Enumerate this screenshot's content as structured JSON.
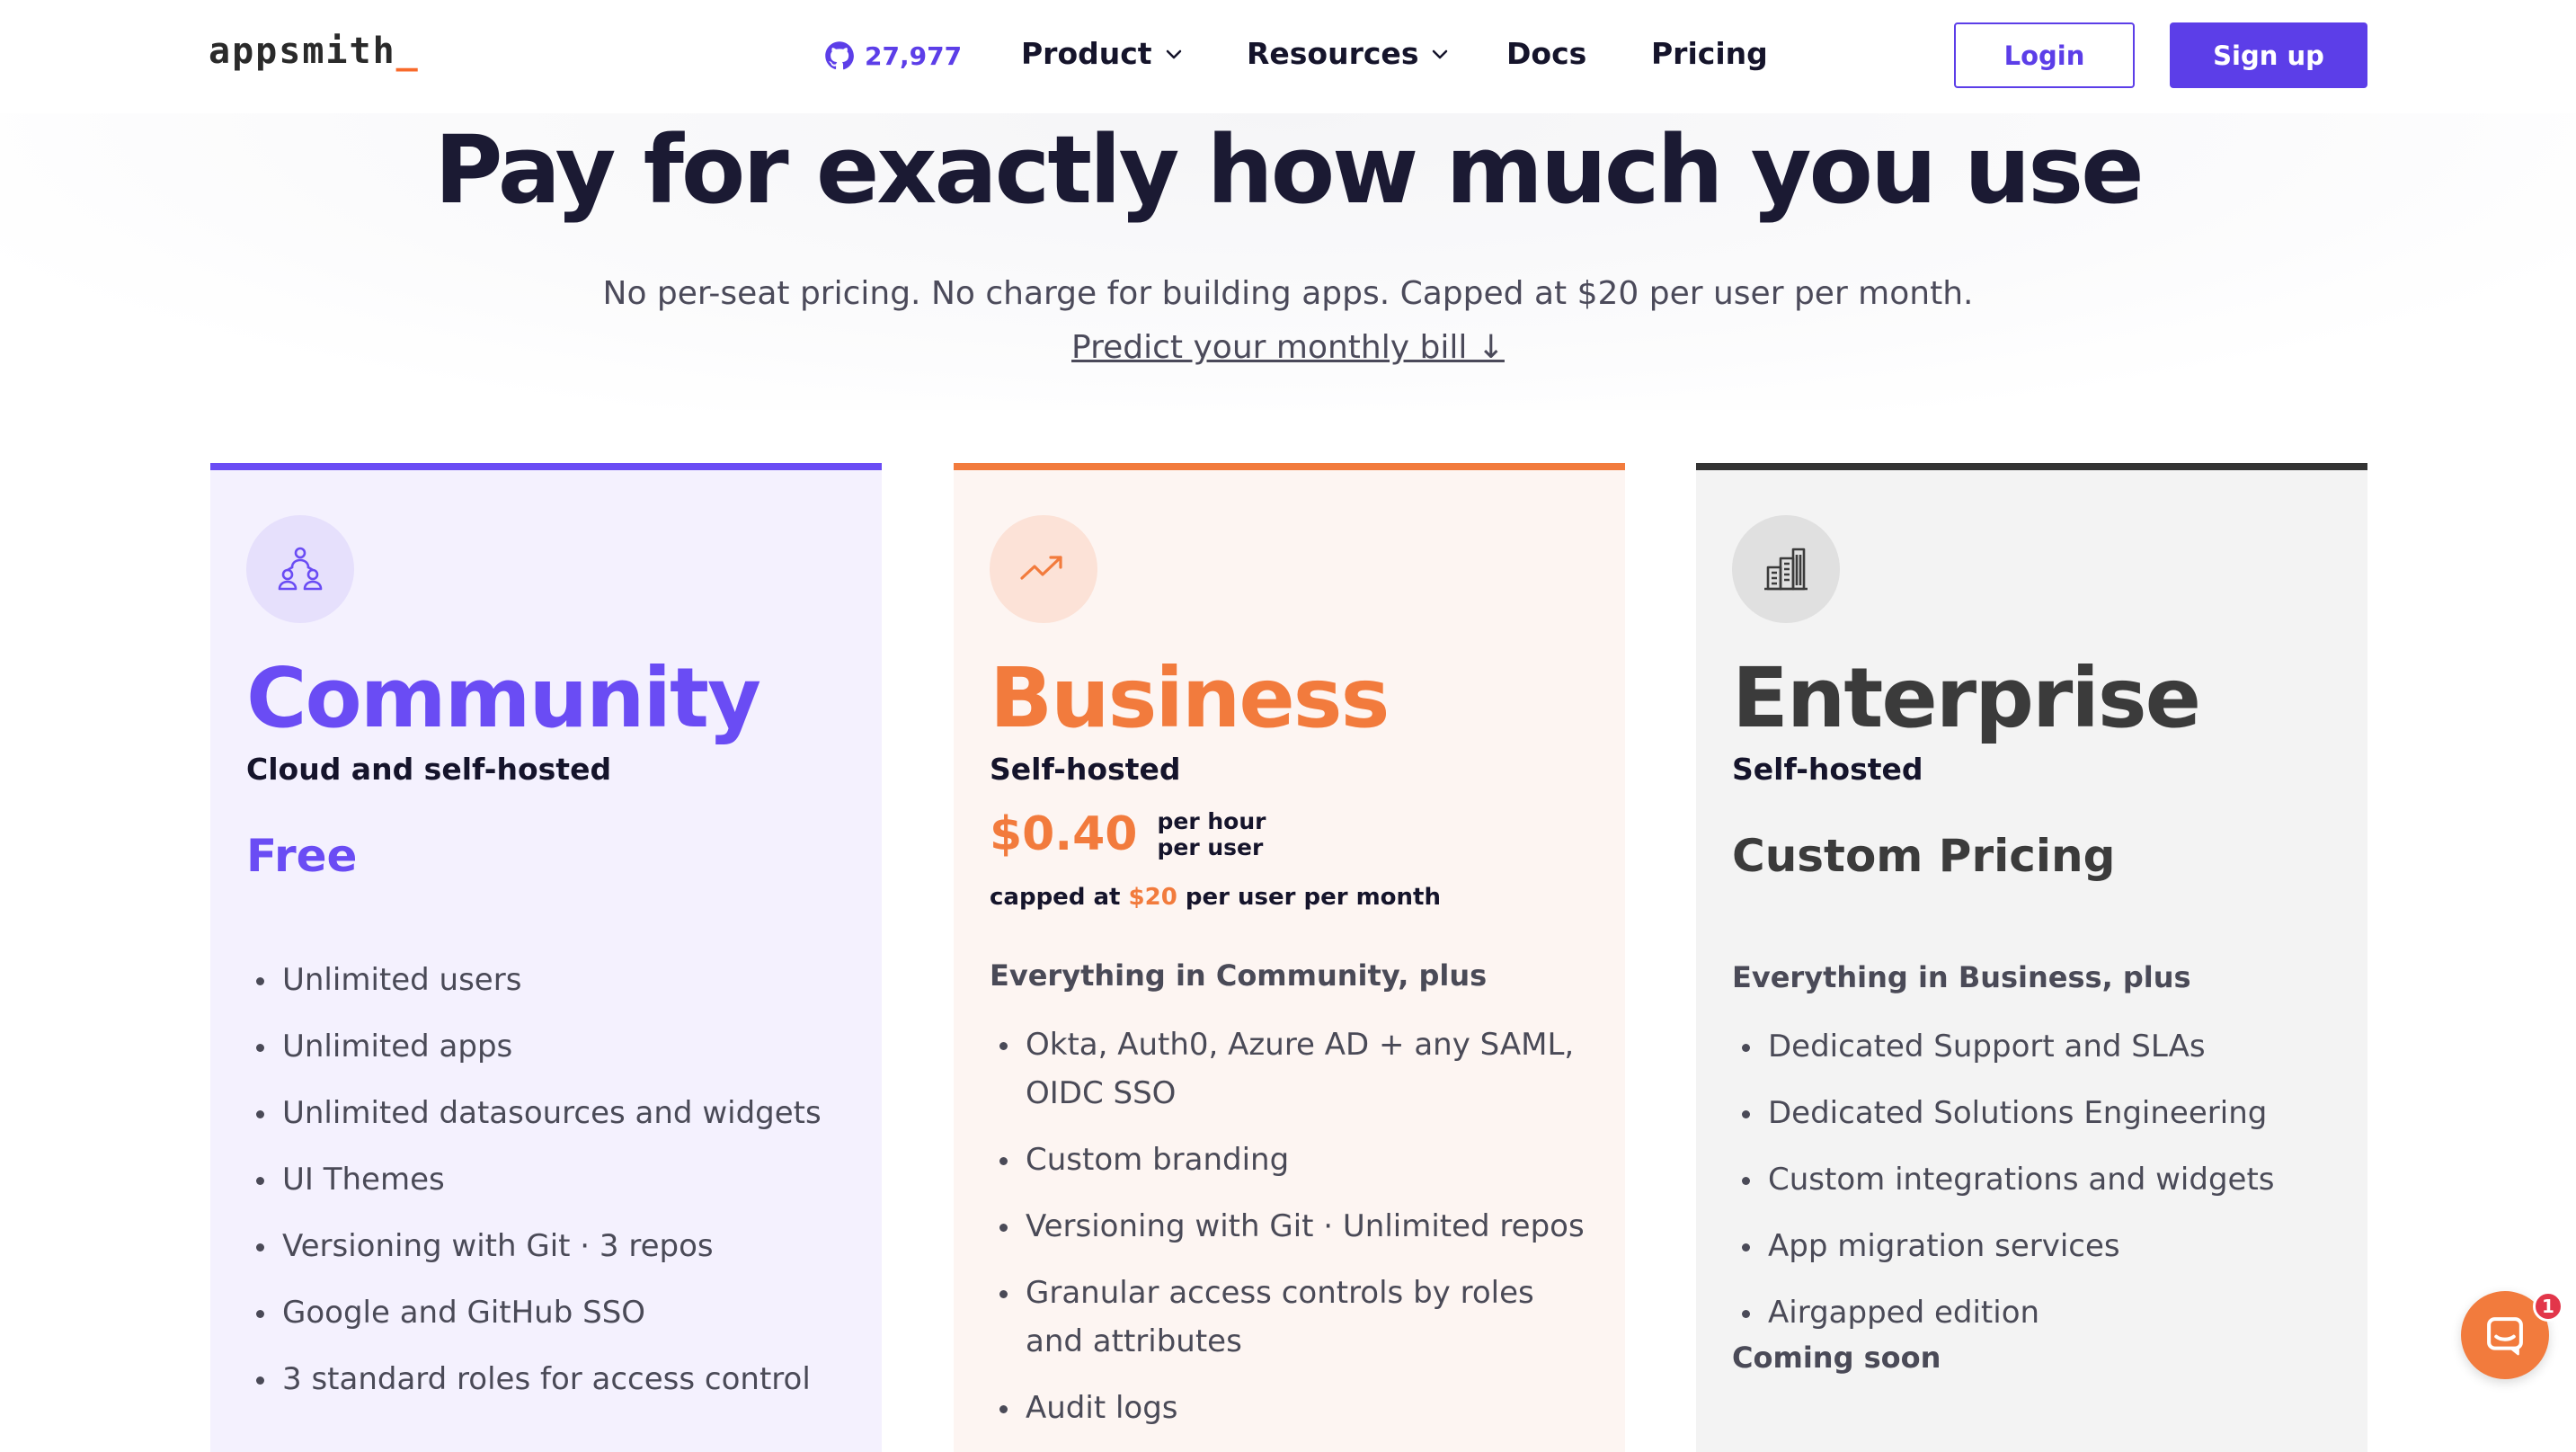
{
  "nav": {
    "logo": "appsmith",
    "logo_cursor": "_",
    "github_stars": "27,977",
    "links": [
      "Product",
      "Resources",
      "Docs",
      "Pricing"
    ],
    "login": "Login",
    "signup": "Sign up"
  },
  "hero": {
    "title": "Pay for exactly how much you use",
    "subtitle": "No per-seat pricing. No charge for building apps. Capped at $20 per user per month.",
    "link": "Predict your monthly bill ↓"
  },
  "plans": {
    "community": {
      "name": "Community",
      "hosting": "Cloud and self-hosted",
      "price": "Free",
      "features": [
        "Unlimited users",
        "Unlimited apps",
        "Unlimited datasources and widgets",
        "UI Themes",
        "Versioning with Git · 3 repos",
        "Google and GitHub SSO",
        "3 standard roles for access control"
      ]
    },
    "business": {
      "name": "Business",
      "hosting": "Self-hosted",
      "price": "$0.40",
      "price_unit_1": "per hour",
      "price_unit_2": "per user",
      "cap_prefix": "capped at ",
      "cap_value": "$20",
      "cap_suffix": " per user per month",
      "plus_heading": "Everything in Community, plus",
      "features": [
        "Okta, Auth0, Azure AD + any SAML, OIDC SSO",
        "Custom branding",
        "Versioning with Git · Unlimited repos",
        "Granular access controls by roles and attributes",
        "Audit logs"
      ]
    },
    "enterprise": {
      "name": "Enterprise",
      "hosting": "Self-hosted",
      "price": "Custom Pricing",
      "plus_heading": "Everything in Business, plus",
      "features": [
        "Dedicated Support and SLAs",
        "Dedicated Solutions Engineering",
        "Custom integrations and widgets",
        "App migration services",
        "Airgapped edition"
      ],
      "coming_soon": "Coming soon"
    }
  },
  "chat": {
    "badge": "1"
  },
  "colors": {
    "brand": "#5c3ee8",
    "community": "#6a4cf4",
    "business": "#f27b3d",
    "enterprise": "#333333"
  }
}
